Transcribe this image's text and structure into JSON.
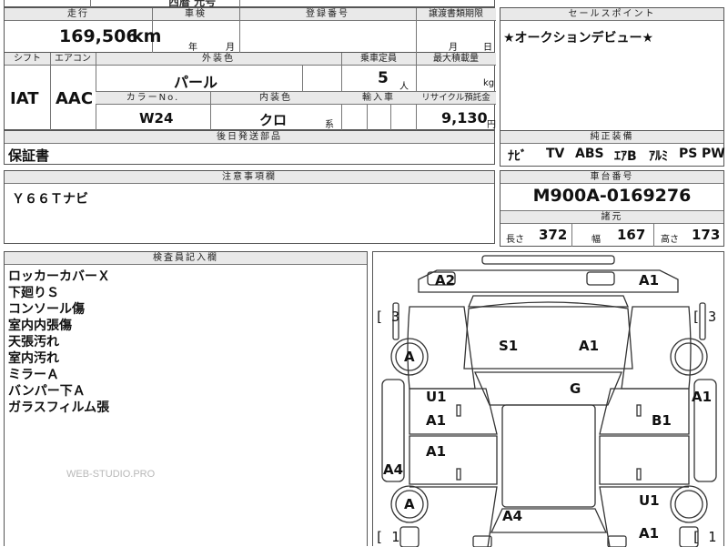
{
  "top_strip": {
    "partial_text": "西暦 元号"
  },
  "mileage": {
    "label": "走行",
    "value": "169,506",
    "unit": "km"
  },
  "inspection": {
    "label": "車検",
    "year_unit": "年",
    "month_unit": "月"
  },
  "registration": {
    "label": "登録番号",
    "value": ""
  },
  "transfer_deadline": {
    "label": "譲渡書類期限",
    "month_unit": "月",
    "day_unit": "日"
  },
  "sales_point": {
    "label": "セールスポイント",
    "text": "★オークションデビュー★"
  },
  "shift": {
    "label": "シフト",
    "value": "IAT"
  },
  "aircon": {
    "label": "エアコン",
    "value": "AAC"
  },
  "exterior_color": {
    "label": "外装色",
    "value": "パール"
  },
  "seating": {
    "label": "乗車定員",
    "value": "5",
    "unit": "人"
  },
  "max_load": {
    "label": "最大積載量",
    "unit": "kg"
  },
  "color_no": {
    "label": "カラーNo.",
    "value": "W24"
  },
  "interior_color": {
    "label": "内装色",
    "value": "クロ",
    "unit": "系"
  },
  "import_car": {
    "label": "輸入車"
  },
  "recycle_fee": {
    "label": "リサイクル預託金",
    "value": "9,130",
    "unit": "円"
  },
  "later_parts": {
    "label": "後日発送部品",
    "value": "保証書"
  },
  "equipment": {
    "label": "純正装備",
    "items": [
      "ﾅﾋﾞ",
      "TV",
      "ABS",
      "ｴｱB",
      "ｱﾙﾐ",
      "PS",
      "PW"
    ]
  },
  "notes": {
    "label": "注意事項欄",
    "text": "Ｙ６６Ｔナビ"
  },
  "chassis": {
    "label": "車台番号",
    "value": "M900A-0169276"
  },
  "specs": {
    "label": "諸元",
    "length_label": "長さ",
    "length": "372",
    "width_label": "幅",
    "width": "167",
    "height_label": "高さ",
    "height": "173"
  },
  "inspector_memo": {
    "label": "検査員記入欄",
    "lines": [
      "ロッカーカバーＸ",
      "下廻りＳ",
      "コンソール傷",
      "室内内張傷",
      "天張汚れ",
      "室内汚れ",
      "ミラーＡ",
      "バンパー下Ａ",
      "ガラスフィルム張"
    ]
  },
  "watermark": "WEB-STUDIO.PRO",
  "damage_marks": {
    "front_left_bumper": "A2",
    "front_right_bumper": "A1",
    "bonnet_center": "S1",
    "bonnet_right": "A1",
    "roof": "G",
    "left_front_wheel": "A",
    "left_rear_wheel": "A",
    "left_door_upper": "U1",
    "left_door_lower": "A1",
    "left_rear_door": "A1",
    "left_sill": "A4",
    "right_fender": "A1",
    "right_door": "B1",
    "right_rear_quarter": "U1",
    "rear_center": "A4",
    "rear_right": "A1"
  },
  "glass_ratings": {
    "front_left": "3",
    "front_right": "3",
    "rear_left": "1",
    "rear_right": "1"
  }
}
